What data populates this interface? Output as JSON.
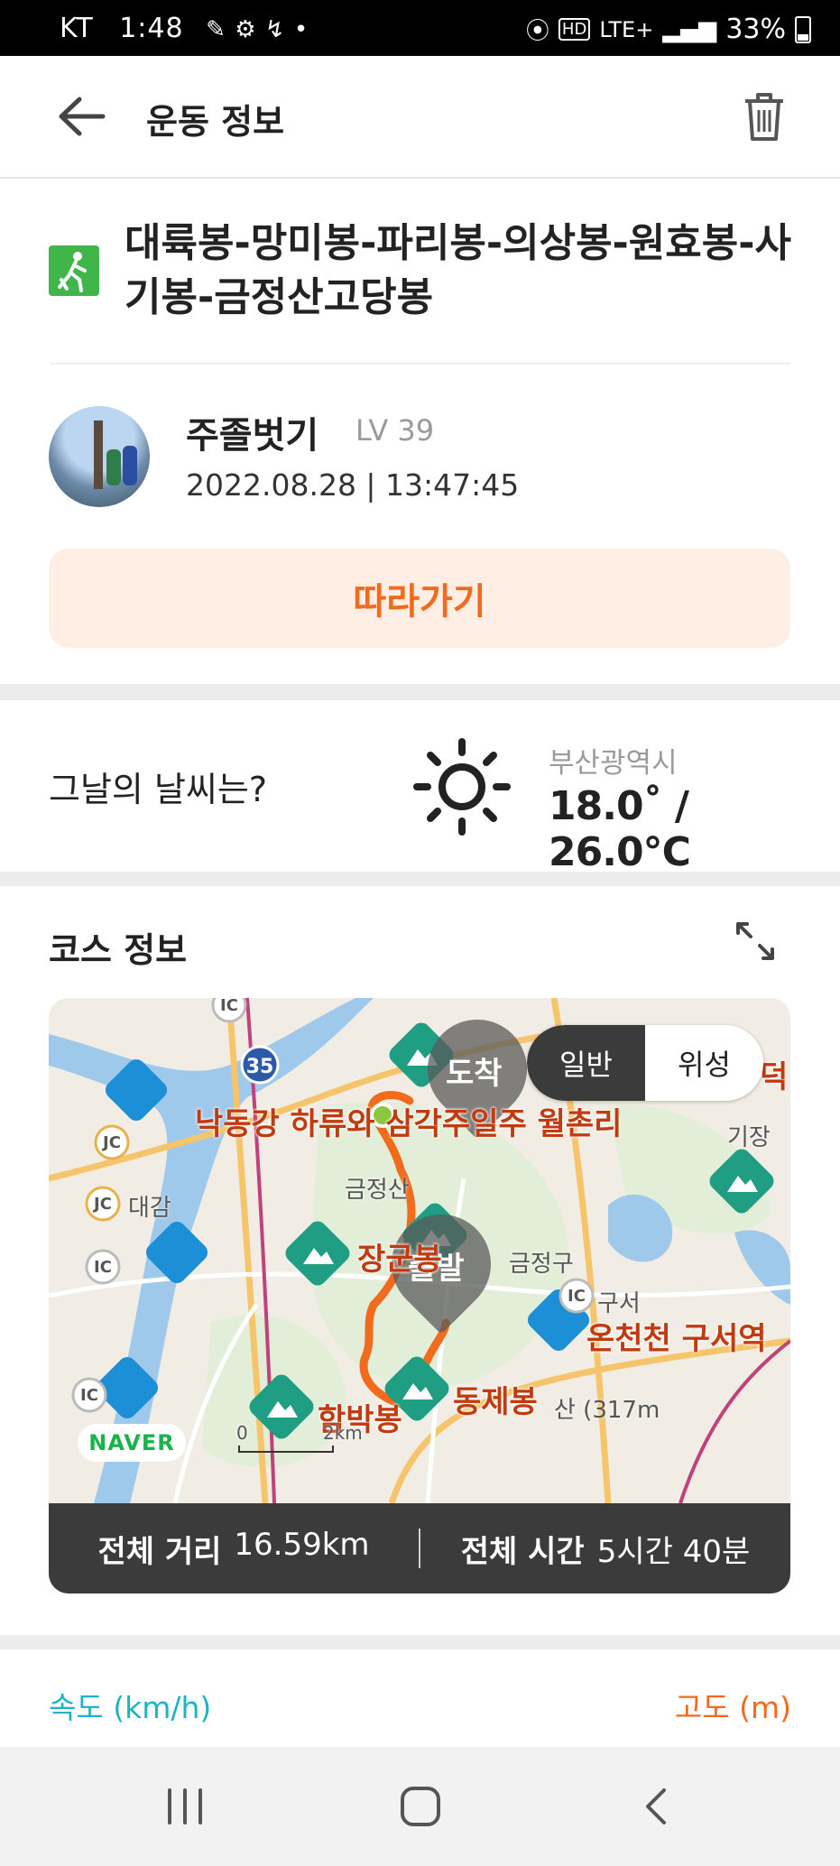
{
  "status_bar": {
    "carrier": "KT",
    "time": "1:48",
    "network": "LTE+",
    "battery": "33%"
  },
  "header": {
    "title": "운동 정보"
  },
  "activity": {
    "route_title": "대륙봉-망미봉-파리봉-의상봉-원효봉-사기봉-금정산고당봉",
    "username": "주졸벗기",
    "level": "LV 39",
    "datetime": "2022.08.28 | 13:47:45",
    "follow_label": "따라가기"
  },
  "weather": {
    "question": "그날의 날씨는?",
    "icon": "sun-icon",
    "city": "부산광역시",
    "temperature": "18.0˚ / 26.0℃"
  },
  "course": {
    "title": "코스 정보",
    "map_toggle": [
      "일반",
      "위성"
    ],
    "map_toggle_selected": "일반",
    "markers": {
      "arrival": "도착",
      "start": "출발"
    },
    "map_labels": {
      "river_park": "낙동강 하류와 삼각주일주 월촌리",
      "jang": "장군봉",
      "hambak": "함박봉",
      "dongje": "동제봉",
      "oncheon": "온천천 구서역",
      "geumjeongsan": "금정산",
      "geumjeong_gu": "금정구",
      "gooseo": "구서",
      "daegam": "대감",
      "gijang": "기장",
      "deok": "덕",
      "san317": "산 (317m",
      "hwy": "35",
      "scale": "2km",
      "scale_zero": "0"
    },
    "naver_badge": "NAVER",
    "total_distance_label": "전체 거리",
    "total_distance": "16.59km",
    "total_time_label": "전체 시간",
    "total_time": "5시간 40분"
  },
  "charts": {
    "speed_label": "속도 (km/h)",
    "altitude_label": "고도 (m)"
  },
  "colors": {
    "accent": "#f36a1f",
    "speed": "#1fb3c6",
    "hike_green": "#3fb54a"
  }
}
